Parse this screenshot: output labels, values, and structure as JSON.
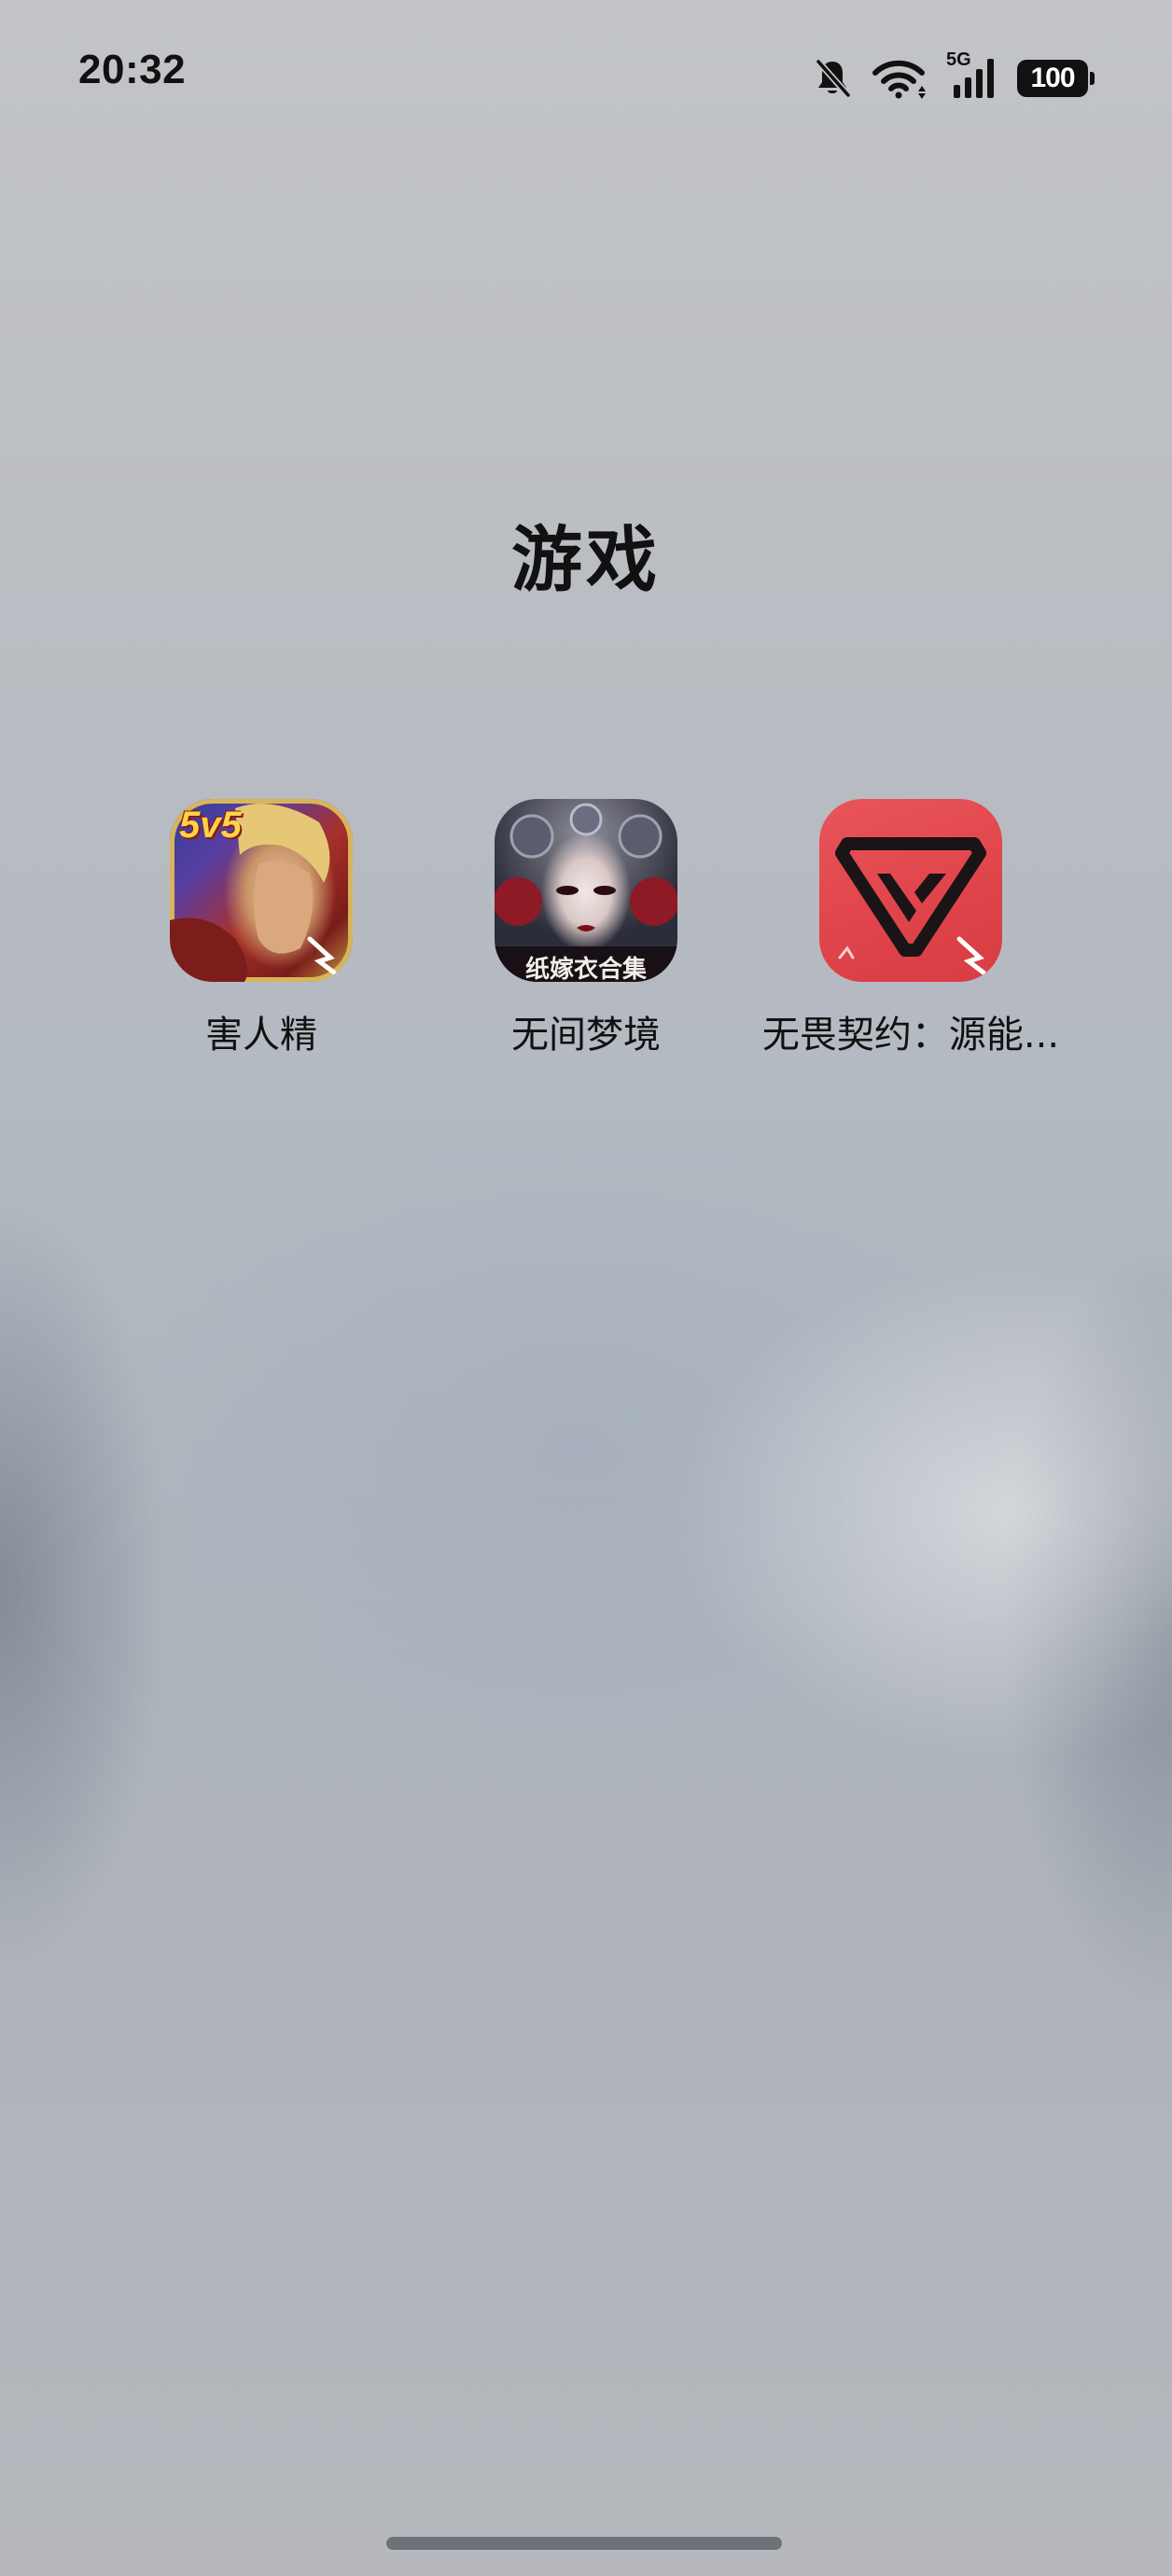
{
  "status_bar": {
    "time": "20:32",
    "network_label": "5G",
    "battery_level": "100",
    "icons": [
      "bell-off-icon",
      "wifi-icon",
      "cellular-5g-icon",
      "battery-icon"
    ]
  },
  "folder": {
    "title": "游戏",
    "apps": [
      {
        "label": "害人精",
        "icon": "honor-of-kings-icon",
        "badge": "5v5"
      },
      {
        "label": "无间梦境",
        "icon": "wujian-mengjing-icon",
        "banner": "纸嫁衣合集"
      },
      {
        "label": "无畏契约：源能...",
        "icon": "valorant-icon"
      }
    ]
  },
  "colors": {
    "valorant_red": "#e2474d",
    "text": "#111111"
  }
}
